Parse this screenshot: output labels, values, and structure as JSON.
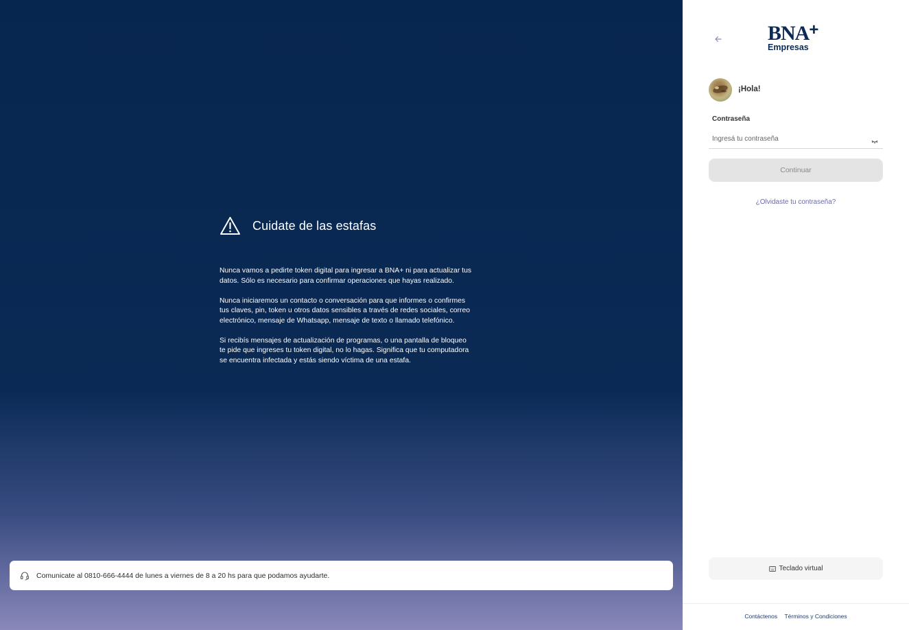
{
  "scam_warning": {
    "title": "Cuidate de las estafas",
    "paragraphs": [
      "Nunca vamos a pedirte token digital para ingresar a BNA+ ni para actualizar tus datos. Sólo es necesario para confirmar operaciones que hayas realizado.",
      "Nunca iniciaremos un contacto o conversación para que informes o confirmes tus claves, pin, token u otros datos sensibles a través de redes sociales, correo electrónico, mensaje de Whatsapp, mensaje de texto o llamado telefónico.",
      "Si recibís mensajes de actualización de programas, o una pantalla de bloqueo te pide que ingreses tu token digital, no lo hagas. Significa que tu computadora se encuentra infectada y estás siendo víctima de una estafa."
    ],
    "icon": "warning-triangle-icon"
  },
  "help_bar": {
    "text": "Comunicate al 0810-666-4444 de lunes a viernes de 8 a 20 hs para que podamos ayudarte.",
    "icon": "headset-icon"
  },
  "login": {
    "logo_main": "BNA",
    "logo_plus": "+",
    "logo_sub": "Empresas",
    "greeting": "¡Hola!",
    "password_label": "Contraseña",
    "password_placeholder": "Ingresá tu contraseña",
    "continue_label": "Continuar",
    "forgot_label": "¿Olvidaste tu contraseña?",
    "virtual_keyboard_label": "Teclado virtual"
  },
  "footer": {
    "contact_label": "Contáctenos",
    "terms_label": "Términos y Condiciones"
  },
  "colors": {
    "brand_navy": "#0b2a55",
    "link_purple": "#6a6aa8",
    "button_disabled": "#e4e4e4"
  }
}
